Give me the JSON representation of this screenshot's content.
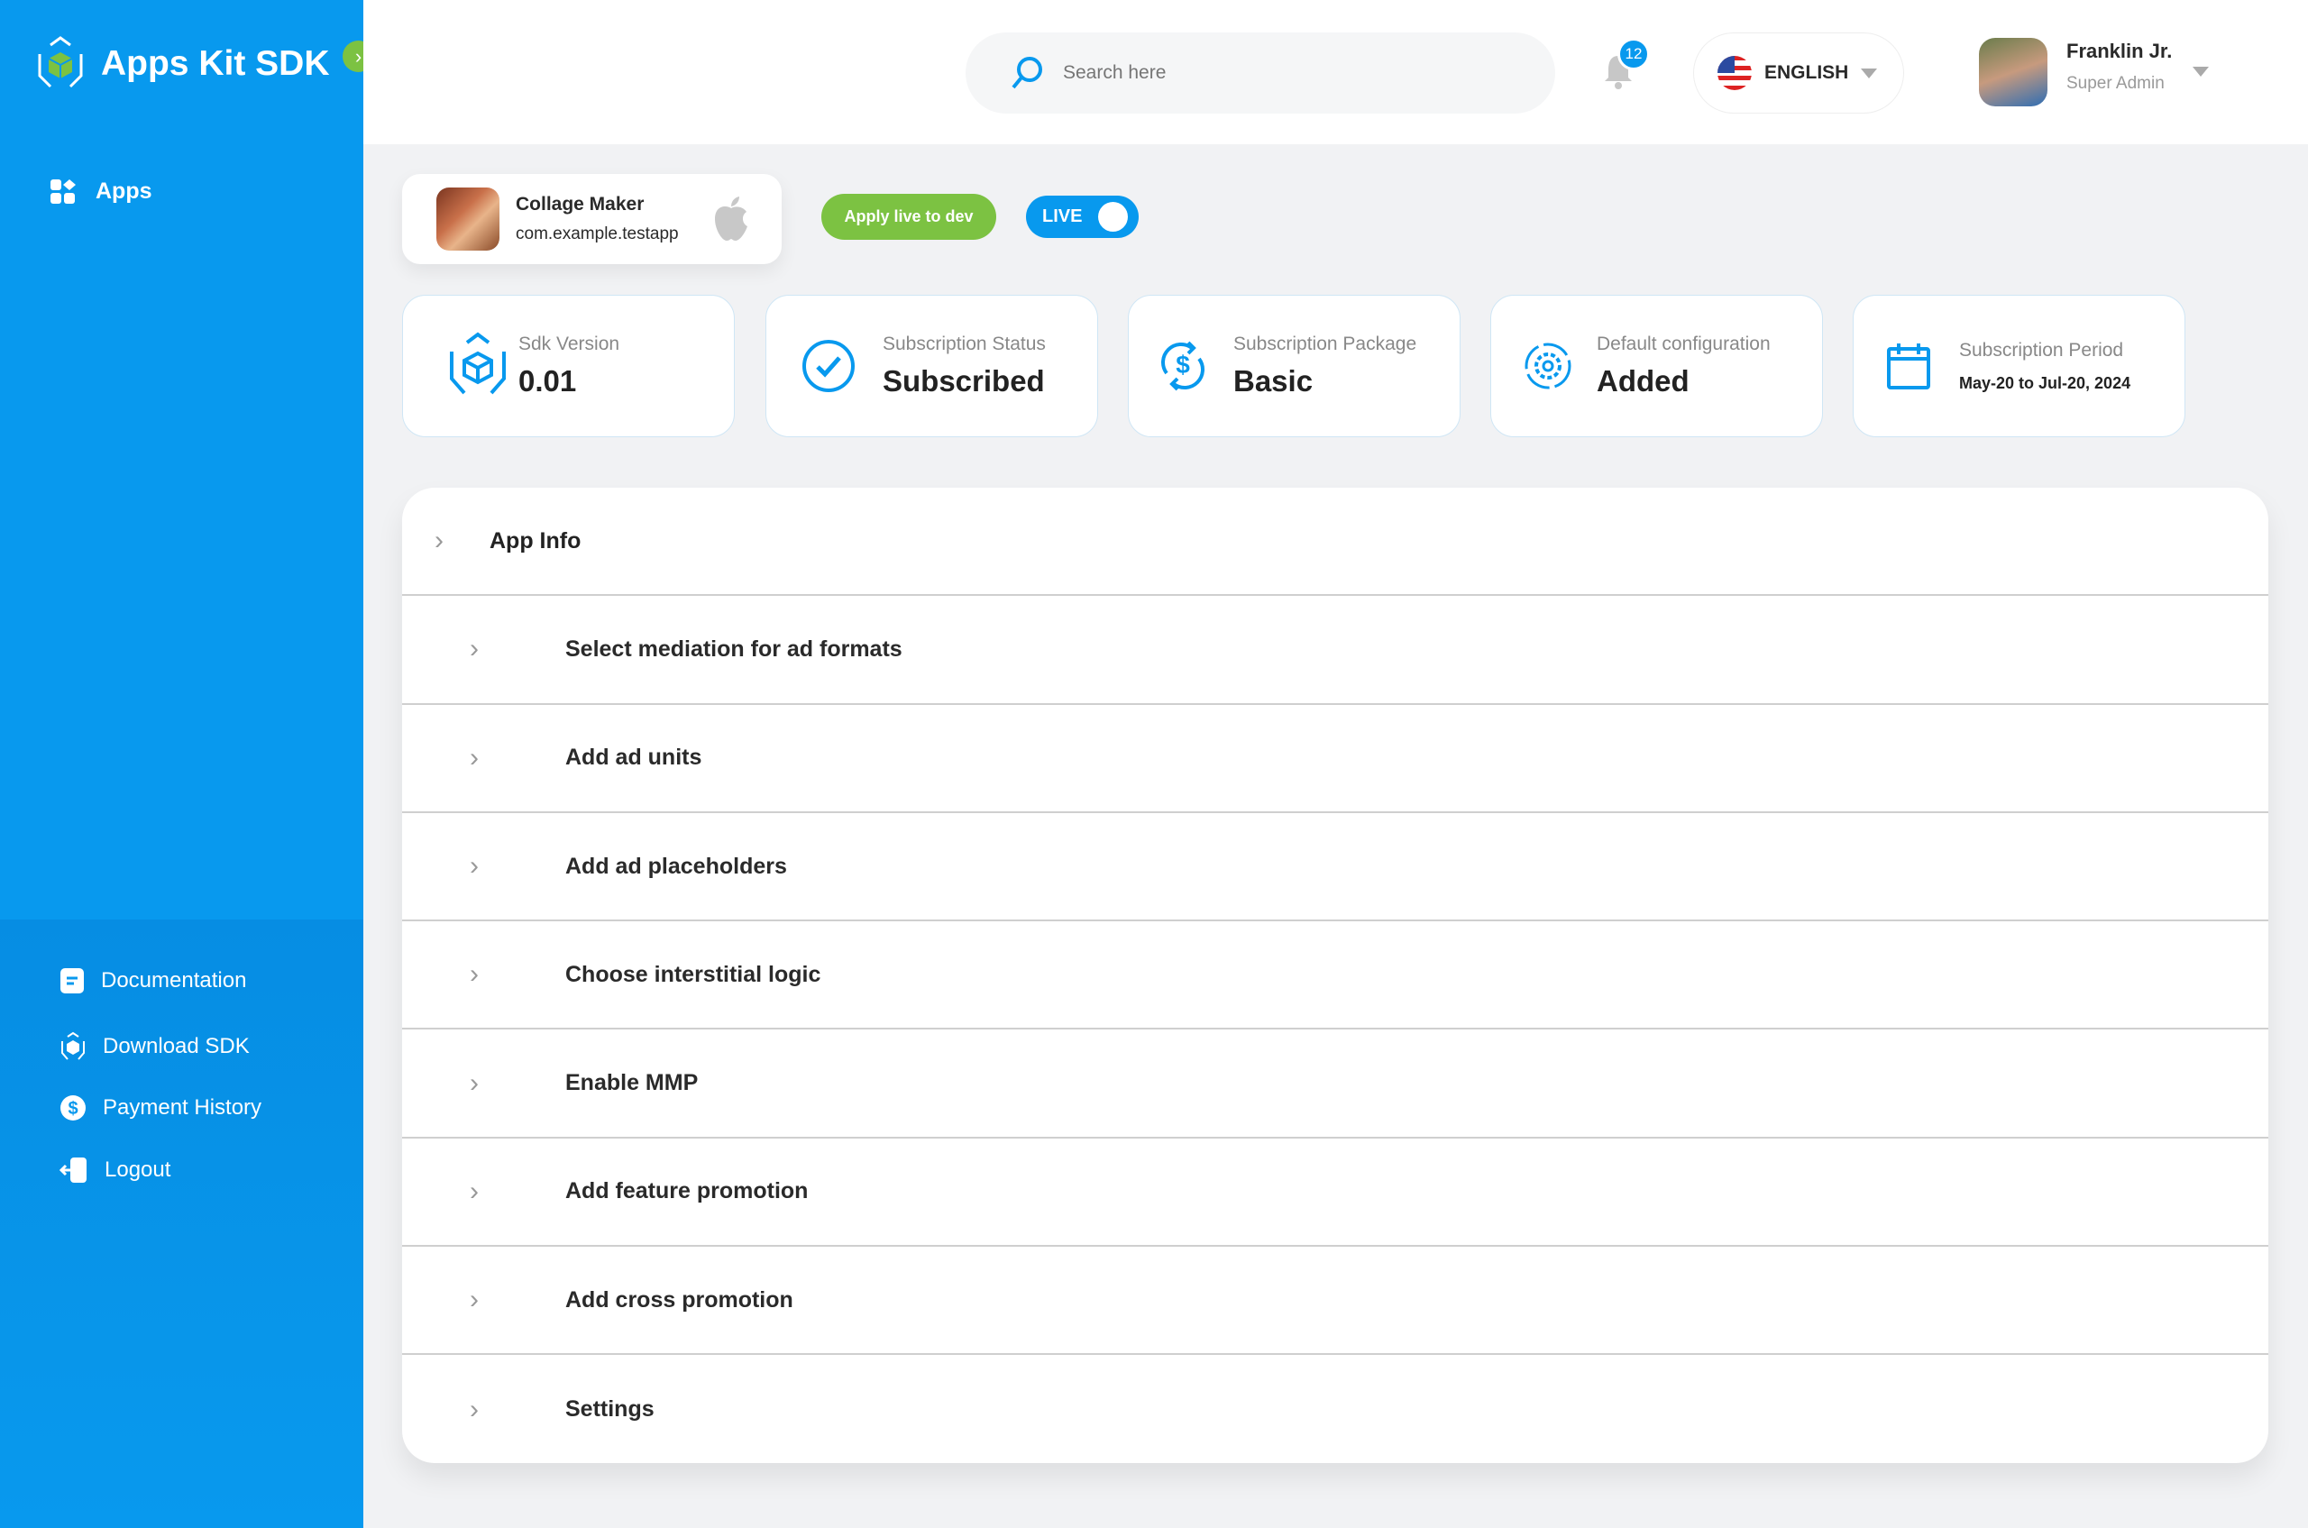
{
  "brand": {
    "name": "Apps Kit SDK"
  },
  "sidebar": {
    "nav": [
      {
        "label": "Apps",
        "icon": "grid-icon"
      }
    ],
    "bottom": [
      {
        "label": "Documentation",
        "icon": "document-icon"
      },
      {
        "label": "Download SDK",
        "icon": "sdk-icon"
      },
      {
        "label": "Payment History",
        "icon": "dollar-icon"
      },
      {
        "label": "Logout",
        "icon": "logout-icon"
      }
    ]
  },
  "header": {
    "search_placeholder": "Search here",
    "notifications": "12",
    "language": "ENGLISH",
    "user": {
      "name": "Franklin Jr.",
      "role": "Super Admin"
    }
  },
  "app": {
    "name": "Collage Maker",
    "package": "com.example.testapp",
    "platform": "apple"
  },
  "actions": {
    "apply": "Apply live to dev",
    "live": "LIVE",
    "live_on": true
  },
  "stats": [
    {
      "label": "Sdk Version",
      "value": "0.01"
    },
    {
      "label": "Subscription Status",
      "value": "Subscribed"
    },
    {
      "label": "Subscription Package",
      "value": "Basic"
    },
    {
      "label": "Default configuration",
      "value": "Added"
    },
    {
      "label": "Subscription Period",
      "value": "May-20 to Jul-20, 2024"
    }
  ],
  "accordion": {
    "title": "App Info",
    "items": [
      "Select mediation for ad formats",
      "Add ad units",
      "Add ad placeholders",
      "Choose interstitial logic",
      "Enable MMP",
      "Add feature promotion",
      "Add cross promotion",
      "Settings"
    ]
  },
  "colors": {
    "primary": "#0899ee",
    "accent": "#7cc242"
  }
}
